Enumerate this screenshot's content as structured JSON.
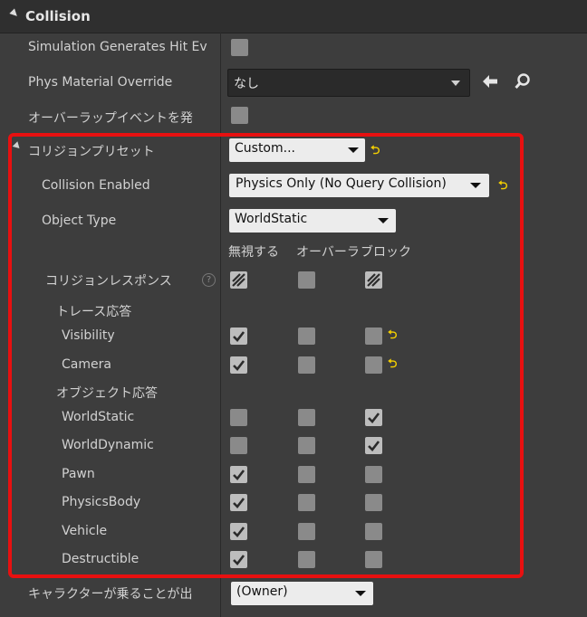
{
  "section": {
    "title": "Collision"
  },
  "rows": {
    "sim_hit": {
      "label": "Simulation Generates Hit Ev"
    },
    "phys_material": {
      "label": "Phys Material Override",
      "value": "なし"
    },
    "overlap": {
      "label": "オーバーラップイベントを発"
    },
    "preset": {
      "label": "コリジョンプリセット",
      "value": "Custom...",
      "reset": "⮌"
    },
    "collision_enabled": {
      "label": "Collision Enabled",
      "value": "Physics Only (No Query Collision)",
      "reset": "⮌"
    },
    "object_type": {
      "label": "Object Type",
      "value": "WorldStatic"
    },
    "responses": {
      "label": "コリジョンレスポンス",
      "info": "?"
    },
    "trace_header": {
      "label": "トレース応答"
    },
    "object_header": {
      "label": "オブジェクト応答"
    },
    "character_step": {
      "label": "キャラクターが乗ることが出",
      "value": "(Owner)"
    }
  },
  "columns": [
    "無視する",
    "オーバーラ",
    "ブロック"
  ],
  "matrix": [
    {
      "name": "Visibility",
      "states": [
        "checked",
        "empty",
        "empty"
      ],
      "reset": "⮌"
    },
    {
      "name": "Camera",
      "states": [
        "checked",
        "empty",
        "empty"
      ],
      "reset": "⮌"
    },
    {
      "name": "WorldStatic",
      "states": [
        "empty",
        "empty",
        "checked"
      ],
      "reset": ""
    },
    {
      "name": "WorldDynamic",
      "states": [
        "empty",
        "empty",
        "checked"
      ],
      "reset": ""
    },
    {
      "name": "Pawn",
      "states": [
        "checked",
        "empty",
        "empty"
      ],
      "reset": ""
    },
    {
      "name": "PhysicsBody",
      "states": [
        "checked",
        "empty",
        "empty"
      ],
      "reset": ""
    },
    {
      "name": "Vehicle",
      "states": [
        "checked",
        "empty",
        "empty"
      ],
      "reset": ""
    },
    {
      "name": "Destructible",
      "states": [
        "checked",
        "empty",
        "empty"
      ],
      "reset": ""
    }
  ],
  "icons": {
    "back": "arrow-left-icon",
    "browse": "magnifier-icon",
    "dropdown": "chevron-down-icon"
  },
  "colors": {
    "highlight": "#e81010",
    "reset": "#f5d000",
    "panel": "#3d3d3d"
  }
}
